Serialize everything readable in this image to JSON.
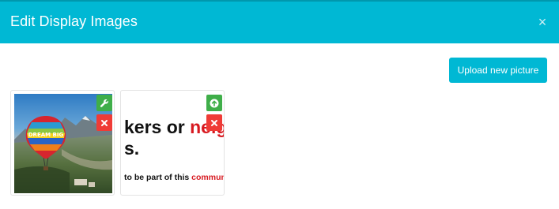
{
  "modal": {
    "title": "Edit Display Images",
    "close_symbol": "×"
  },
  "toolbar": {
    "upload_label": "Upload new picture"
  },
  "images": [
    {
      "kind": "photo",
      "subject": "hot-air balloon over valley",
      "balloon_text": "DREAM BIG",
      "top_action_icon": "wrench-icon",
      "bottom_action_icon": "close-icon"
    },
    {
      "kind": "text-graphic",
      "line1_black": "kers or ",
      "line1_red": "neig",
      "line2": "s.",
      "line3_black": " to be part of this ",
      "line3_red": "communit",
      "top_action_icon": "arrow-up-circle-icon",
      "bottom_action_icon": "close-icon"
    }
  ],
  "colors": {
    "header": "#00b8d4",
    "primary": "#00b8d4",
    "success": "#3fae49",
    "danger": "#ef3b36",
    "accent_red": "#d71920"
  }
}
